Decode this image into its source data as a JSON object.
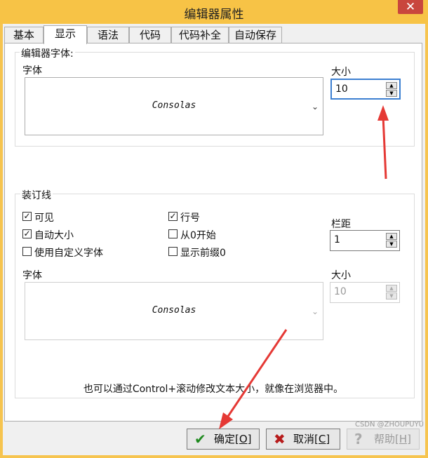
{
  "window": {
    "title": "编辑器属性",
    "close": "✕"
  },
  "tabs": [
    {
      "label": "基本",
      "active": false
    },
    {
      "label": "显示",
      "active": true
    },
    {
      "label": "语法",
      "active": false
    },
    {
      "label": "代码",
      "active": false
    },
    {
      "label": "代码补全",
      "active": false
    },
    {
      "label": "自动保存",
      "active": false
    }
  ],
  "editor_font": {
    "group_title": "编辑器字体:",
    "font_label": "字体",
    "font_value": "Consolas",
    "size_label": "大小",
    "size_value": "10"
  },
  "gutter": {
    "group_title": "装订线",
    "checkboxes": [
      {
        "label": "可见",
        "checked": true
      },
      {
        "label": "自动大小",
        "checked": true
      },
      {
        "label": "使用自定义字体",
        "checked": false
      },
      {
        "label": "行号",
        "checked": true
      },
      {
        "label": "从0开始",
        "checked": false
      },
      {
        "label": "显示前缀0",
        "checked": false
      }
    ],
    "margin_label": "栏距",
    "margin_value": "1",
    "font_label": "字体",
    "font_value": "Consolas",
    "size_label": "大小",
    "size_value": "10"
  },
  "hint": "也可以通过Control+滚动修改文本大小，就像在浏览器中。",
  "buttons": {
    "ok": {
      "label": "确定",
      "key": "[O]",
      "icon": "checkmark-icon"
    },
    "cancel": {
      "label": "取消",
      "key": "[C]",
      "icon": "x-icon"
    },
    "help": {
      "label": "帮助",
      "key": "[H]",
      "icon": "question-icon"
    }
  },
  "watermark": "CSDN @ZHOUPUYU",
  "colors": {
    "titlebar": "#f7c346",
    "close": "#c9463d",
    "annotation_arrow": "#e53935",
    "focus": "#3c7fd1"
  }
}
